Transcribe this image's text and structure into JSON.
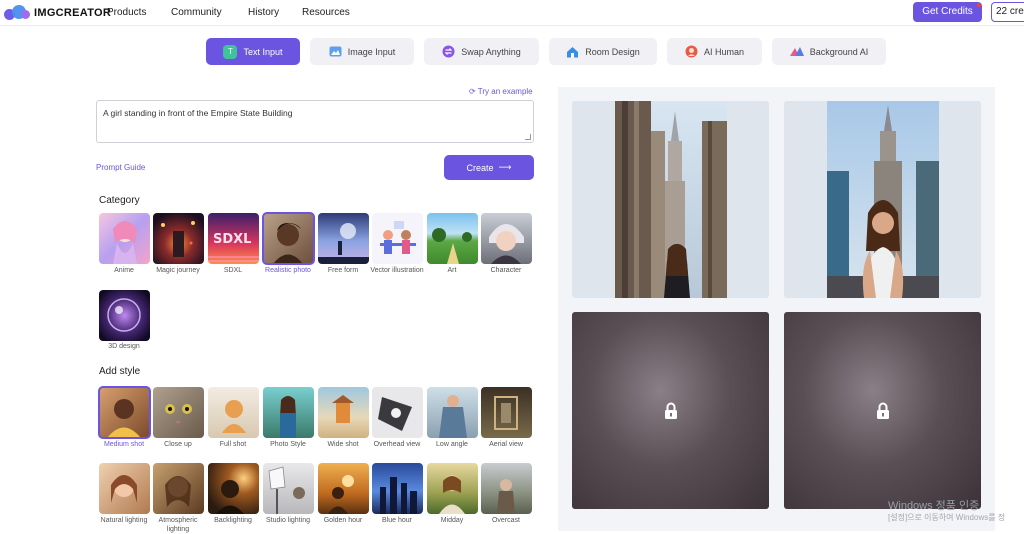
{
  "app": {
    "logo_text": "IMGCREATOR",
    "nav": [
      "Products",
      "Community",
      "History",
      "Resources"
    ],
    "get_credits": "Get Credits",
    "credit_count": "22 cre"
  },
  "tabs": [
    {
      "label": "Text Input",
      "icon": "text-t-icon",
      "active": true
    },
    {
      "label": "Image Input",
      "icon": "image-icon",
      "active": false
    },
    {
      "label": "Swap Anything",
      "icon": "swap-icon",
      "active": false
    },
    {
      "label": "Room Design",
      "icon": "house-icon",
      "active": false
    },
    {
      "label": "AI Human",
      "icon": "person-icon",
      "active": false
    },
    {
      "label": "Background AI",
      "icon": "background-icon",
      "active": false
    }
  ],
  "prompt": {
    "try_example": "Try an example",
    "value": "A girl standing in front of the Empire State Building",
    "guide": "Prompt Guide",
    "create": "Create"
  },
  "category": {
    "title": "Category",
    "items": [
      {
        "label": "Anime",
        "selected": false
      },
      {
        "label": "Magic journey",
        "selected": false
      },
      {
        "label": "SDXL",
        "selected": false
      },
      {
        "label": "Realistic photo",
        "selected": true
      },
      {
        "label": "Free form",
        "selected": false
      },
      {
        "label": "Vector illustration",
        "selected": false
      },
      {
        "label": "Art",
        "selected": false
      },
      {
        "label": "Character",
        "selected": false
      },
      {
        "label": "3D design",
        "selected": false
      }
    ]
  },
  "style": {
    "title": "Add style",
    "items": [
      {
        "label": "Medium shot",
        "selected": true
      },
      {
        "label": "Close up",
        "selected": false
      },
      {
        "label": "Full shot",
        "selected": false
      },
      {
        "label": "Photo Style",
        "selected": false
      },
      {
        "label": "Wide shot",
        "selected": false
      },
      {
        "label": "Overhead view",
        "selected": false
      },
      {
        "label": "Low angle",
        "selected": false
      },
      {
        "label": "Aerial view",
        "selected": false
      },
      {
        "label": "Natural lighting",
        "selected": false
      },
      {
        "label": "Atmospheric lighting",
        "selected": false
      },
      {
        "label": "Backlighting",
        "selected": false
      },
      {
        "label": "Studio lighting",
        "selected": false
      },
      {
        "label": "Golden hour",
        "selected": false
      },
      {
        "label": "Blue hour",
        "selected": false
      },
      {
        "label": "Midday",
        "selected": false
      },
      {
        "label": "Overcast",
        "selected": false
      }
    ]
  },
  "results": {
    "locked_icon": "lock-icon"
  },
  "watermark": {
    "line1": "Windows 정품 인증",
    "line2": "[설정]으로 이동하여 Windows를 정"
  },
  "colors": {
    "accent": "#6b55e0",
    "tab_bg": "#f1f1f5"
  }
}
